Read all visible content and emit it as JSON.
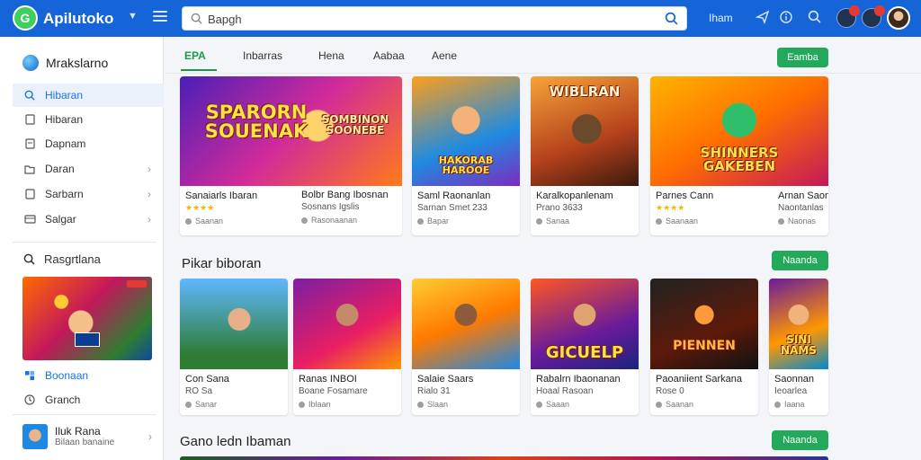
{
  "app": {
    "name": "Apilutoko"
  },
  "search": {
    "value": "Bapgh"
  },
  "topbar": {
    "link": "Iham"
  },
  "colors": {
    "primary": "#1565d8",
    "accent": "#22a95a",
    "active_tab": "#1a9a4a"
  },
  "sidebar": {
    "header": "Mrakslarno",
    "items": [
      {
        "label": "Hibaran",
        "icon": "search-icon",
        "active": true
      },
      {
        "label": "Hibaran",
        "icon": "file-icon"
      },
      {
        "label": "Dapnam",
        "icon": "doc-icon"
      },
      {
        "label": "Daran",
        "icon": "folder-icon"
      },
      {
        "label": "Sarbarn",
        "icon": "doc-icon"
      },
      {
        "label": "Salgar",
        "icon": "card-icon"
      }
    ],
    "section2": "Rasgrtlana",
    "links": [
      {
        "label": "Boonaan",
        "icon": "puzzle-icon"
      },
      {
        "label": "Granch",
        "icon": "clock-icon"
      }
    ],
    "user": {
      "name": "Iluk Rana",
      "sub": "Bilaan banaine"
    }
  },
  "tabs": [
    {
      "label": "EPA",
      "active": true
    },
    {
      "label": "Inbarras"
    },
    {
      "label": "Hena"
    },
    {
      "label": "Aabaa"
    },
    {
      "label": "Aene"
    }
  ],
  "buttons": {
    "top": "Eamba",
    "section2": "Naanda",
    "section3": "Naanda"
  },
  "sections": {
    "row2_title": "Pikar biboran",
    "row3_title": "Gano ledn Ibaman"
  },
  "thumb_text": {
    "c1": "SPARORN SOUENAK",
    "c1b": "SOMBINON SOONEBE",
    "c2": "HAKORAB HAROOE",
    "c3": "WIBLRAN",
    "c4": "SHINNERS GAKEBEN",
    "c8": "GICUELP",
    "c9": "PIENNEN",
    "c10": "SINI NAMS"
  },
  "row1": [
    {
      "title": "Sanaiarls Ibaran",
      "sub": "",
      "meta": "Saanan",
      "rating": 4
    },
    {
      "title": "Bolbr Bang Ibosnan",
      "sub": "Sosnans Igslis",
      "meta": "Rasonaanan",
      "rating": 0
    },
    {
      "title": "Saml Raonanlan",
      "sub": "Sarnan Smet 233",
      "meta": "Bapar",
      "rating": 0
    },
    {
      "title": "Karalkopanlenam",
      "sub": "Prano 3633",
      "meta": "Sanaa",
      "rating": 0
    },
    {
      "title": "Parnes Cann",
      "sub": "",
      "meta": "Saanaan",
      "rating": 4
    },
    {
      "title": "Arnan Saono",
      "sub": "Naontanlas",
      "meta": "Naonas",
      "rating": 0
    }
  ],
  "row2": [
    {
      "title": "Con Sana",
      "sub": "RO Sa",
      "meta": "Sanar"
    },
    {
      "title": "Ranas INBOI",
      "sub": "Boane Fosamare",
      "meta": "Iblaan"
    },
    {
      "title": "Salaie Saars",
      "sub": "Rialo 31",
      "meta": "Slaan"
    },
    {
      "title": "Rabalrn Ibaonanan",
      "sub": "Hoaal Rasoan",
      "meta": "Saaan"
    },
    {
      "title": "Paoaniient Sarkana",
      "sub": "Rose 0",
      "meta": "Saanan"
    },
    {
      "title": "Saonnan",
      "sub": "Ieoarlea",
      "meta": "Iaana"
    }
  ]
}
